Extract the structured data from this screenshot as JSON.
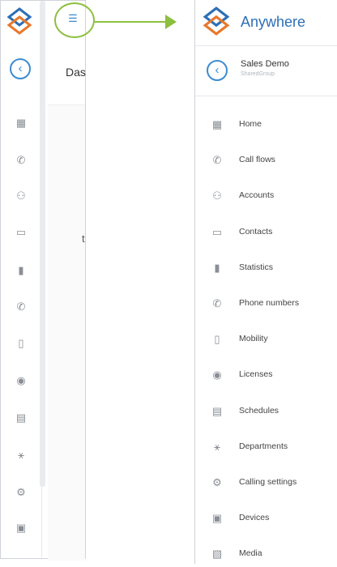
{
  "left_panel": {
    "title_partial": "Das",
    "partial_letter": "t",
    "menu_icon": "list-icon",
    "rail_icons": [
      "home-icon",
      "call-flows-icon",
      "accounts-icon",
      "contacts-icon",
      "statistics-icon",
      "phone-numbers-icon",
      "mobility-icon",
      "licenses-icon",
      "schedules-icon",
      "departments-icon",
      "calling-settings-icon",
      "devices-icon"
    ]
  },
  "right_panel": {
    "brand": "Anywhere",
    "org_name": "Sales Demo",
    "org_sub": "SharedGroup",
    "nav": [
      {
        "label": "Home",
        "icon": "home-icon"
      },
      {
        "label": "Call flows",
        "icon": "call-flows-icon"
      },
      {
        "label": "Accounts",
        "icon": "accounts-icon"
      },
      {
        "label": "Contacts",
        "icon": "contacts-icon"
      },
      {
        "label": "Statistics",
        "icon": "statistics-icon"
      },
      {
        "label": "Phone numbers",
        "icon": "phone-numbers-icon"
      },
      {
        "label": "Mobility",
        "icon": "mobility-icon"
      },
      {
        "label": "Licenses",
        "icon": "licenses-icon"
      },
      {
        "label": "Schedules",
        "icon": "schedules-icon"
      },
      {
        "label": "Departments",
        "icon": "departments-icon"
      },
      {
        "label": "Calling settings",
        "icon": "calling-settings-icon"
      },
      {
        "label": "Devices",
        "icon": "devices-icon"
      },
      {
        "label": "Media",
        "icon": "media-icon"
      }
    ]
  },
  "colors": {
    "accent": "#3d8cd0",
    "highlight": "#8dbf3f",
    "logo_orange": "#e8782b",
    "logo_blue": "#2d6fb5"
  }
}
